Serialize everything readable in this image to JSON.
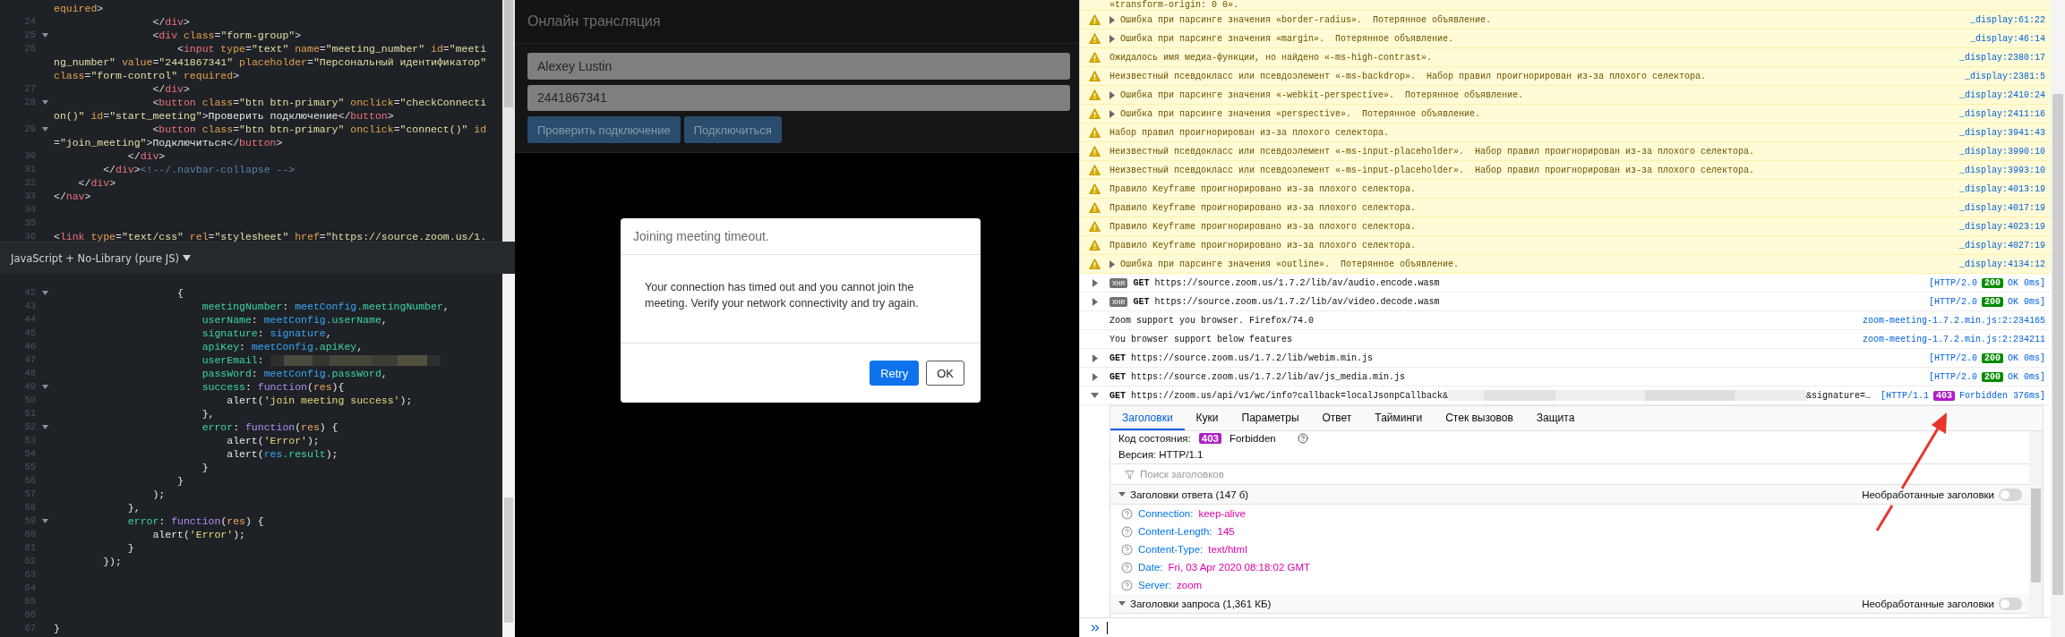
{
  "editor": {
    "top_rows": [
      {
        "fold": false,
        "tokens": [
          {
            "kind": "attr",
            "text": "equired"
          },
          {
            "kind": "punct",
            "text": ">"
          }
        ]
      },
      {
        "number": "24",
        "fold": false,
        "indent": "                ",
        "tokens": [
          {
            "kind": "punct",
            "text": "</"
          },
          {
            "kind": "tag",
            "text": "div"
          },
          {
            "kind": "punct",
            "text": ">"
          }
        ]
      },
      {
        "number": "25",
        "fold": true,
        "indent": "                ",
        "tokens": [
          {
            "kind": "punct",
            "text": "<"
          },
          {
            "kind": "tag",
            "text": "div"
          },
          {
            "kind": "attr",
            "text": " class"
          },
          {
            "kind": "punct",
            "text": "="
          },
          {
            "kind": "str",
            "text": "\"form-group\""
          },
          {
            "kind": "punct",
            "text": ">"
          }
        ]
      },
      {
        "number": "26",
        "fold": false,
        "indent": "                    ",
        "tokens": [
          {
            "kind": "punct",
            "text": "<"
          },
          {
            "kind": "tag",
            "text": "input"
          },
          {
            "kind": "attr",
            "text": " type"
          },
          {
            "kind": "punct",
            "text": "="
          },
          {
            "kind": "str",
            "text": "\"text\""
          },
          {
            "kind": "attr",
            "text": " name"
          },
          {
            "kind": "punct",
            "text": "="
          },
          {
            "kind": "str",
            "text": "\"meeting_number\""
          },
          {
            "kind": "attr",
            "text": " id"
          },
          {
            "kind": "punct",
            "text": "="
          },
          {
            "kind": "str",
            "text": "\"meeti"
          }
        ]
      },
      {
        "fold": false,
        "tokens": [
          {
            "kind": "str",
            "text": "ng_number\""
          },
          {
            "kind": "attr",
            "text": " value"
          },
          {
            "kind": "punct",
            "text": "="
          },
          {
            "kind": "str",
            "text": "\"2441867341\""
          },
          {
            "kind": "attr",
            "text": " placeholder"
          },
          {
            "kind": "punct",
            "text": "="
          },
          {
            "kind": "str",
            "text": "\"Персональный идентификатор\""
          }
        ]
      },
      {
        "fold": false,
        "tokens": [
          {
            "kind": "attr",
            "text": "class"
          },
          {
            "kind": "punct",
            "text": "="
          },
          {
            "kind": "str",
            "text": "\"form-control\""
          },
          {
            "kind": "attr",
            "text": " required"
          },
          {
            "kind": "punct",
            "text": ">"
          }
        ]
      },
      {
        "number": "27",
        "fold": false,
        "indent": "                ",
        "tokens": [
          {
            "kind": "punct",
            "text": "</"
          },
          {
            "kind": "tag",
            "text": "div"
          },
          {
            "kind": "punct",
            "text": ">"
          }
        ]
      },
      {
        "number": "28",
        "fold": true,
        "indent": "                ",
        "tokens": [
          {
            "kind": "punct",
            "text": "<"
          },
          {
            "kind": "tag",
            "text": "button"
          },
          {
            "kind": "attr",
            "text": " class"
          },
          {
            "kind": "punct",
            "text": "="
          },
          {
            "kind": "str",
            "text": "\"btn btn-primary\""
          },
          {
            "kind": "attr",
            "text": " onclick"
          },
          {
            "kind": "punct",
            "text": "="
          },
          {
            "kind": "str",
            "text": "\"checkConnecti"
          }
        ]
      },
      {
        "fold": false,
        "tokens": [
          {
            "kind": "str",
            "text": "on()\""
          },
          {
            "kind": "attr",
            "text": " id"
          },
          {
            "kind": "punct",
            "text": "="
          },
          {
            "kind": "str",
            "text": "\"start_meeting\""
          },
          {
            "kind": "punct",
            "text": ">"
          },
          {
            "kind": "text",
            "text": "Проверить подключение"
          },
          {
            "kind": "punct",
            "text": "</"
          },
          {
            "kind": "tag",
            "text": "button"
          },
          {
            "kind": "punct",
            "text": ">"
          }
        ]
      },
      {
        "number": "29",
        "fold": true,
        "indent": "                ",
        "tokens": [
          {
            "kind": "punct",
            "text": "<"
          },
          {
            "kind": "tag",
            "text": "button"
          },
          {
            "kind": "attr",
            "text": " class"
          },
          {
            "kind": "punct",
            "text": "="
          },
          {
            "kind": "str",
            "text": "\"btn btn-primary\""
          },
          {
            "kind": "attr",
            "text": " onclick"
          },
          {
            "kind": "punct",
            "text": "="
          },
          {
            "kind": "str",
            "text": "\"connect()\""
          },
          {
            "kind": "attr",
            "text": " id"
          }
        ]
      },
      {
        "fold": false,
        "tokens": [
          {
            "kind": "punct",
            "text": "="
          },
          {
            "kind": "str",
            "text": "\"join_meeting\""
          },
          {
            "kind": "punct",
            "text": ">"
          },
          {
            "kind": "text",
            "text": "Подключиться"
          },
          {
            "kind": "punct",
            "text": "</"
          },
          {
            "kind": "tag",
            "text": "button"
          },
          {
            "kind": "punct",
            "text": ">"
          }
        ]
      },
      {
        "number": "30",
        "fold": false,
        "indent": "            ",
        "tokens": [
          {
            "kind": "punct",
            "text": "</"
          },
          {
            "kind": "tag",
            "text": "div"
          },
          {
            "kind": "punct",
            "text": ">"
          }
        ]
      },
      {
        "number": "31",
        "fold": false,
        "indent": "        ",
        "tokens": [
          {
            "kind": "punct",
            "text": "</"
          },
          {
            "kind": "tag",
            "text": "div"
          },
          {
            "kind": "punct",
            "text": ">"
          },
          {
            "kind": "comment",
            "text": "<!--/.navbar-collapse -->"
          }
        ]
      },
      {
        "number": "32",
        "fold": false,
        "indent": "    ",
        "tokens": [
          {
            "kind": "punct",
            "text": "</"
          },
          {
            "kind": "tag",
            "text": "div"
          },
          {
            "kind": "punct",
            "text": ">"
          }
        ]
      },
      {
        "number": "33",
        "fold": false,
        "tokens": [
          {
            "kind": "punct",
            "text": "</"
          },
          {
            "kind": "tag",
            "text": "nav"
          },
          {
            "kind": "punct",
            "text": ">"
          }
        ]
      },
      {
        "number": "34",
        "fold": false
      },
      {
        "number": "35",
        "fold": false
      },
      {
        "number": "36",
        "fold": false,
        "tokens": [
          {
            "kind": "punct",
            "text": "<"
          },
          {
            "kind": "tag",
            "text": "link"
          },
          {
            "kind": "attr",
            "text": " type"
          },
          {
            "kind": "punct",
            "text": "="
          },
          {
            "kind": "str",
            "text": "\"text/css\""
          },
          {
            "kind": "attr",
            "text": " rel"
          },
          {
            "kind": "punct",
            "text": "="
          },
          {
            "kind": "str",
            "text": "\"stylesheet\""
          },
          {
            "kind": "attr",
            "text": " href"
          },
          {
            "kind": "punct",
            "text": "="
          },
          {
            "kind": "str",
            "text": "\"https://source.zoom.us/1."
          }
        ]
      }
    ],
    "language_bar": {
      "label": "JavaScript + No-Library (pure JS)"
    },
    "bottom_rows": [
      {
        "number": "42",
        "fold": true,
        "indent": "                    ",
        "tokens": [
          {
            "kind": "plain",
            "text": "{"
          }
        ]
      },
      {
        "number": "43",
        "fold": false,
        "indent": "                        ",
        "tokens": [
          {
            "kind": "prop",
            "text": "meetingNumber"
          },
          {
            "kind": "plain",
            "text": ": "
          },
          {
            "kind": "ident",
            "text": "meetConfig"
          },
          {
            "kind": "prop",
            "text": ".meetingNumber"
          },
          {
            "kind": "plain",
            "text": ","
          }
        ]
      },
      {
        "number": "44",
        "fold": false,
        "indent": "                        ",
        "tokens": [
          {
            "kind": "prop",
            "text": "userName"
          },
          {
            "kind": "plain",
            "text": ": "
          },
          {
            "kind": "ident",
            "text": "meetConfig"
          },
          {
            "kind": "prop",
            "text": ".userName"
          },
          {
            "kind": "plain",
            "text": ","
          }
        ]
      },
      {
        "number": "45",
        "fold": false,
        "indent": "                        ",
        "tokens": [
          {
            "kind": "prop",
            "text": "signature"
          },
          {
            "kind": "plain",
            "text": ": "
          },
          {
            "kind": "ident",
            "text": "signature"
          },
          {
            "kind": "plain",
            "text": ","
          }
        ]
      },
      {
        "number": "46",
        "fold": false,
        "indent": "                        ",
        "tokens": [
          {
            "kind": "prop",
            "text": "apiKey"
          },
          {
            "kind": "plain",
            "text": ": "
          },
          {
            "kind": "ident",
            "text": "meetConfig"
          },
          {
            "kind": "prop",
            "text": ".apiKey"
          },
          {
            "kind": "plain",
            "text": ","
          }
        ]
      },
      {
        "number": "47",
        "fold": false,
        "indent": "                        ",
        "tokens": [
          {
            "kind": "prop",
            "text": "userEmail"
          },
          {
            "kind": "plain",
            "text": ": "
          },
          {
            "kind": "redacted"
          }
        ]
      },
      {
        "number": "48",
        "fold": false,
        "indent": "                        ",
        "tokens": [
          {
            "kind": "prop",
            "text": "passWord"
          },
          {
            "kind": "plain",
            "text": ": "
          },
          {
            "kind": "ident",
            "text": "meetConfig"
          },
          {
            "kind": "prop",
            "text": ".passWord"
          },
          {
            "kind": "plain",
            "text": ","
          }
        ]
      },
      {
        "number": "49",
        "fold": true,
        "indent": "                        ",
        "tokens": [
          {
            "kind": "prop",
            "text": "success"
          },
          {
            "kind": "plain",
            "text": ": "
          },
          {
            "kind": "kw",
            "text": "function"
          },
          {
            "kind": "plain",
            "text": "("
          },
          {
            "kind": "param",
            "text": "res"
          },
          {
            "kind": "plain",
            "text": "){"
          }
        ]
      },
      {
        "number": "50",
        "fold": false,
        "indent": "                            ",
        "tokens": [
          {
            "kind": "plain",
            "text": "alert("
          },
          {
            "kind": "jsstr",
            "text": "'join meeting success'"
          },
          {
            "kind": "plain",
            "text": ");"
          }
        ]
      },
      {
        "number": "51",
        "fold": false,
        "indent": "                        ",
        "tokens": [
          {
            "kind": "plain",
            "text": "},"
          }
        ]
      },
      {
        "number": "52",
        "fold": true,
        "indent": "                        ",
        "tokens": [
          {
            "kind": "prop",
            "text": "error"
          },
          {
            "kind": "plain",
            "text": ": "
          },
          {
            "kind": "kw",
            "text": "function"
          },
          {
            "kind": "plain",
            "text": "("
          },
          {
            "kind": "param",
            "text": "res"
          },
          {
            "kind": "plain",
            "text": ") {"
          }
        ]
      },
      {
        "number": "53",
        "fold": false,
        "indent": "                            ",
        "tokens": [
          {
            "kind": "plain",
            "text": "alert("
          },
          {
            "kind": "jsstr",
            "text": "'Error'"
          },
          {
            "kind": "plain",
            "text": ");"
          }
        ]
      },
      {
        "number": "54",
        "fold": false,
        "indent": "                            ",
        "tokens": [
          {
            "kind": "plain",
            "text": "alert("
          },
          {
            "kind": "ident",
            "text": "res"
          },
          {
            "kind": "prop",
            "text": ".result"
          },
          {
            "kind": "plain",
            "text": ");"
          }
        ]
      },
      {
        "number": "55",
        "fold": false,
        "indent": "                        ",
        "tokens": [
          {
            "kind": "plain",
            "text": "}"
          }
        ]
      },
      {
        "number": "56",
        "fold": false,
        "indent": "                    ",
        "tokens": [
          {
            "kind": "plain",
            "text": "}"
          }
        ]
      },
      {
        "number": "57",
        "fold": false,
        "indent": "                ",
        "tokens": [
          {
            "kind": "plain",
            "text": ");"
          }
        ]
      },
      {
        "number": "58",
        "fold": false,
        "indent": "            ",
        "tokens": [
          {
            "kind": "plain",
            "text": "},"
          }
        ]
      },
      {
        "number": "59",
        "fold": true,
        "indent": "            ",
        "tokens": [
          {
            "kind": "prop",
            "text": "error"
          },
          {
            "kind": "plain",
            "text": ": "
          },
          {
            "kind": "kw",
            "text": "function"
          },
          {
            "kind": "plain",
            "text": "("
          },
          {
            "kind": "param",
            "text": "res"
          },
          {
            "kind": "plain",
            "text": ") {"
          }
        ]
      },
      {
        "number": "60",
        "fold": false,
        "indent": "                ",
        "tokens": [
          {
            "kind": "plain",
            "text": "alert("
          },
          {
            "kind": "jsstr",
            "text": "'Error'"
          },
          {
            "kind": "plain",
            "text": ");"
          }
        ]
      },
      {
        "number": "61",
        "fold": false,
        "indent": "            ",
        "tokens": [
          {
            "kind": "plain",
            "text": "}"
          }
        ]
      },
      {
        "number": "62",
        "fold": false,
        "indent": "        ",
        "tokens": [
          {
            "kind": "plain",
            "text": "});"
          }
        ]
      },
      {
        "number": "63",
        "fold": false
      },
      {
        "number": "64",
        "fold": false
      },
      {
        "number": "65",
        "fold": false
      },
      {
        "number": "66",
        "fold": false
      },
      {
        "number": "67",
        "fold": false,
        "tokens": [
          {
            "kind": "plain",
            "text": "}"
          }
        ]
      }
    ]
  },
  "preview": {
    "navbar": {
      "title": "Онлайн трансляция"
    },
    "fields": [
      {
        "value": "Alexey Lustin"
      },
      {
        "value": "2441867341"
      }
    ],
    "buttons": [
      "Проверить подключение",
      "Подключиться"
    ],
    "dialog": {
      "title": "Joining meeting timeout.",
      "message": "Your connection has timed out and you cannot join the meeting. Verify your network connectivity and try again.",
      "buttons": [
        {
          "label": "Retry",
          "kind": "primary"
        },
        {
          "label": "OK",
          "kind": "secondary"
        }
      ]
    }
  },
  "console": {
    "messages": [
      {
        "kind": "continuation",
        "text": "«transform-origin: 0 0»."
      },
      {
        "kind": "warning",
        "collapsible": true,
        "text": "Ошибка при парсинге значения «border-radius».  Потерянное объявление.",
        "source": "_display:61:22"
      },
      {
        "kind": "warning",
        "collapsible": true,
        "text": "Ошибка при парсинге значения «margin».  Потерянное объявление.",
        "source": "_display:46:14"
      },
      {
        "kind": "warning",
        "collapsible": false,
        "text": "Ожидалось имя медиа-функции, но найдено «-ms-high-contrast».",
        "source": "_display:2380:17"
      },
      {
        "kind": "warning",
        "collapsible": false,
        "text": "Неизвестный псевдокласс или псевдоэлемент «-ms-backdrop».  Набор правил проигнорирован из-за плохого селектора.",
        "source": "_display:2381:5"
      },
      {
        "kind": "warning",
        "collapsible": true,
        "text": "Ошибка при парсинге значения «-webkit-perspective».  Потерянное объявление.",
        "source": "_display:2410:24"
      },
      {
        "kind": "warning",
        "collapsible": true,
        "text": "Ошибка при парсинге значения «perspective».  Потерянное объявление.",
        "source": "_display:2411:16"
      },
      {
        "kind": "warning",
        "collapsible": false,
        "text": "Набор правил проигнорирован из-за плохого селектора.",
        "source": "_display:3941:43"
      },
      {
        "kind": "warning",
        "collapsible": false,
        "text": "Неизвестный псевдокласс или псевдоэлемент «-ms-input-placeholder».  Набор правил проигнорирован из-за плохого селектора.",
        "source": "_display:3990:10"
      },
      {
        "kind": "warning",
        "collapsible": false,
        "text": "Неизвестный псевдокласс или псевдоэлемент «-ms-input-placeholder».  Набор правил проигнорирован из-за плохого селектора.",
        "source": "_display:3993:10"
      },
      {
        "kind": "warning",
        "collapsible": false,
        "text": "Правило Keyframe проигнорировано из-за плохого селектора.",
        "source": "_display:4013:19"
      },
      {
        "kind": "warning",
        "collapsible": false,
        "text": "Правило Keyframe проигнорировано из-за плохого селектора.",
        "source": "_display:4017:19"
      },
      {
        "kind": "warning",
        "collapsible": false,
        "text": "Правило Keyframe проигнорировано из-за плохого селектора.",
        "source": "_display:4023:19"
      },
      {
        "kind": "warning",
        "collapsible": false,
        "text": "Правило Keyframe проигнорировано из-за плохого селектора.",
        "source": "_display:4027:19"
      },
      {
        "kind": "warning",
        "collapsible": true,
        "text": "Ошибка при парсинге значения «outline».  Потерянное объявление.",
        "source": "_display:4134:12"
      },
      {
        "kind": "network",
        "expanded": false,
        "badge": "XHR",
        "method": "GET",
        "url": "https://source.zoom.us/1.7.2/lib/av/audio.encode.wasm",
        "protocol": "[HTTP/2.0",
        "status": "200",
        "color": "#058b00",
        "status_text": "OK 0ms]"
      },
      {
        "kind": "network",
        "expanded": false,
        "badge": "XHR",
        "method": "GET",
        "url": "https://source.zoom.us/1.7.2/lib/av/video.decode.wasm",
        "protocol": "[HTTP/2.0",
        "status": "200",
        "color": "#058b00",
        "status_text": "OK 0ms]"
      },
      {
        "kind": "log",
        "text": "Zoom support you browser. Firefox/74.0",
        "source": "zoom-meeting-1.7.2.min.js:2:234165"
      },
      {
        "kind": "log",
        "text": "You browser support below features",
        "source": "zoom-meeting-1.7.2.min.js:2:234211"
      },
      {
        "kind": "network",
        "expanded": false,
        "method": "GET",
        "url": "https://source.zoom.us/1.7.2/lib/webim.min.js",
        "protocol": "[HTTP/2.0",
        "status": "200",
        "color": "#058b00",
        "status_text": "OK 0ms]"
      },
      {
        "kind": "network",
        "expanded": false,
        "method": "GET",
        "url": "https://source.zoom.us/1.7.2/lib/av/js_media.min.js",
        "protocol": "[HTTP/2.0",
        "status": "200",
        "color": "#058b00",
        "status_text": "OK 0ms]"
      },
      {
        "kind": "network",
        "expanded": true,
        "method": "GET",
        "url_parts": [
          {
            "kind": "text",
            "text": "https://zoom.us/api/v1/wc/info?callback=localJsonpCallback&"
          },
          {
            "kind": "redacted"
          },
          {
            "kind": "text",
            "text": "&signature=…"
          }
        ],
        "protocol": "[HTTP/1.1",
        "status": "403",
        "color": "#b11cc9",
        "status_text": "Forbidden 376ms]"
      }
    ],
    "details": {
      "tabs": [
        {
          "label": "Заголовки",
          "selected": true
        },
        {
          "label": "Куки",
          "selected": false
        },
        {
          "label": "Параметры",
          "selected": false
        },
        {
          "label": "Ответ",
          "selected": false
        },
        {
          "label": "Тайминги",
          "selected": false
        },
        {
          "label": "Стек вызовов",
          "selected": false
        },
        {
          "label": "Защита",
          "selected": false
        }
      ],
      "status": {
        "label": "Код состояния:",
        "code": "403",
        "color": "#b11cc9",
        "text": "Forbidden"
      },
      "version": "Версия: HTTP/1.1",
      "filter": {
        "placeholder": "Поиск заголовков"
      },
      "sections": [
        {
          "title": "Заголовки ответа (147 б)",
          "expanded": true,
          "raw": {
            "label": "Необработанные заголовки",
            "on": false
          },
          "headers": [
            {
              "name": "Connection:",
              "value": "keep-alive"
            },
            {
              "name": "Content-Length:",
              "value": "145"
            },
            {
              "name": "Content-Type:",
              "value": "text/html"
            },
            {
              "name": "Date:",
              "value": "Fri, 03 Apr 2020 08:18:02 GMT"
            },
            {
              "name": "Server:",
              "value": "zoom"
            }
          ]
        },
        {
          "title": "Заголовки запроса (1,361 КБ)",
          "expanded": true,
          "raw": {
            "label": "Необработанные заголовки",
            "on": false
          }
        }
      ]
    }
  }
}
